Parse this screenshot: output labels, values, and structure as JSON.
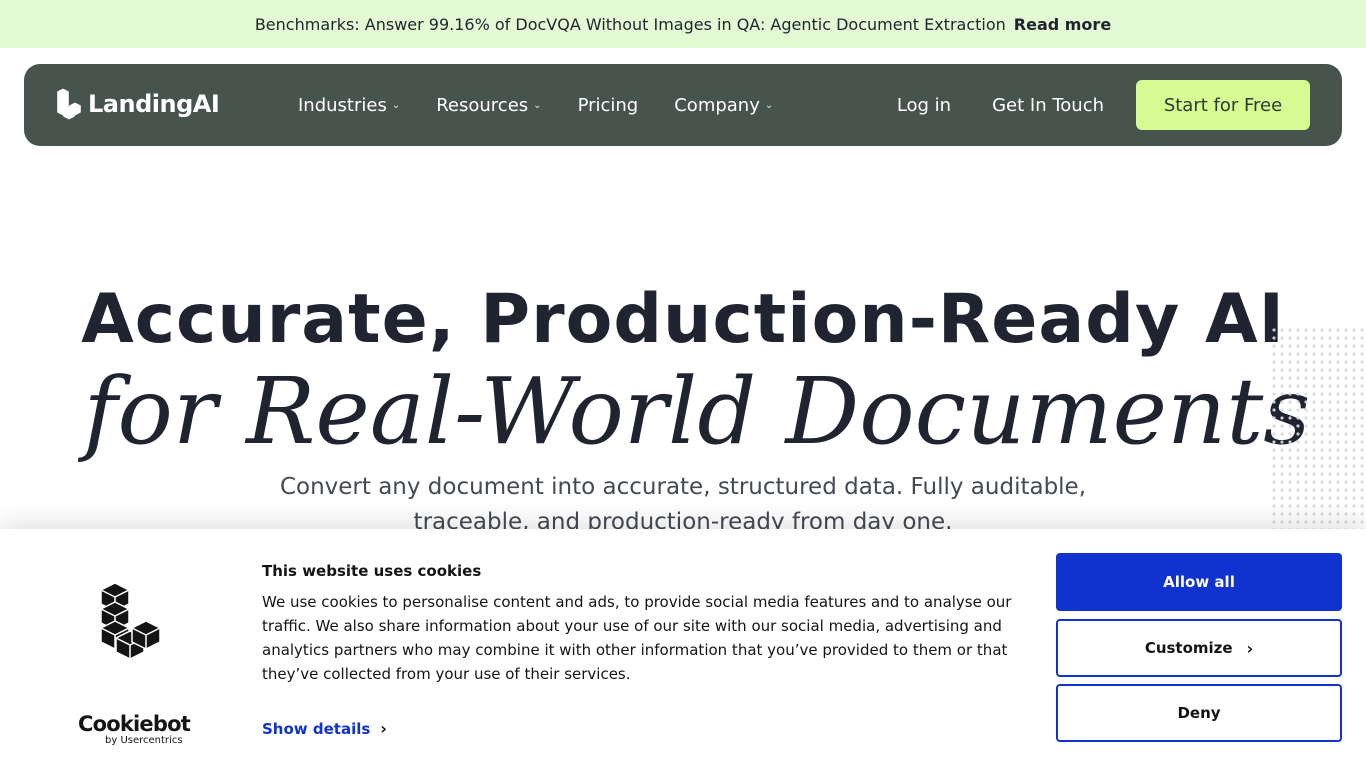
{
  "announcement": {
    "text": "Benchmarks: Answer 99.16% of DocVQA Without Images in QA: Agentic Document Extraction",
    "link": "Read more"
  },
  "nav": {
    "logo_text": "LandingAI",
    "menu": [
      {
        "label": "Industries",
        "dropdown": true
      },
      {
        "label": "Resources",
        "dropdown": true
      },
      {
        "label": "Pricing",
        "dropdown": false
      },
      {
        "label": "Company",
        "dropdown": true
      }
    ],
    "login": "Log in",
    "contact": "Get In Touch",
    "cta": "Start for Free"
  },
  "hero": {
    "title": "Accurate, Production-Ready AI",
    "subtitle": "for Real-World Documents",
    "description": "Convert any document into accurate, structured data. Fully auditable, traceable, and production-ready from day one."
  },
  "cookie_banner": {
    "title": "This website uses cookies",
    "body": "We use cookies to personalise content and ads, to provide social media features and to analyse our traffic. We also share information about your use of our site with our social media, advertising and analytics partners who may combine it with other information that you’ve provided to them or that they’ve collected from your use of their services.",
    "show_details": "Show details",
    "allow_all": "Allow all",
    "customize": "Customize",
    "deny": "Deny",
    "brand_name": "Cookiebot",
    "brand_by": "by Usercentrics"
  },
  "colors": {
    "announcement_bg": "#e3f9d3",
    "nav_bg": "#47544d",
    "cta_bg": "#d8fa93",
    "cookie_accent": "#1032cf"
  },
  "icons": {
    "chevron": "chevron-down-icon",
    "arrow": "chevron-right-icon"
  }
}
